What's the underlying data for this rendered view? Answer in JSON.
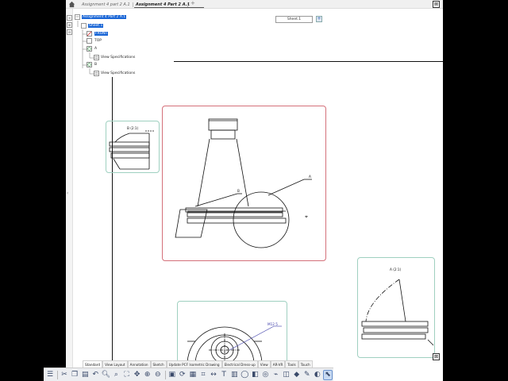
{
  "tabs": [
    {
      "label": "Assignment 4 part 2 A.1",
      "active": false
    },
    {
      "label": "Assignment 4 Part 2 A.1",
      "active": true
    }
  ],
  "add_tab_symbol": "+",
  "sheet_selector": {
    "value": "Sheet.1",
    "add_symbol": "+"
  },
  "tree": {
    "root": "Assignment 4 Part 2 A.1",
    "sheet": "Sheet.1",
    "views": [
      {
        "label": "FRONT",
        "selected": true
      },
      {
        "label": "TOP",
        "selected": false
      },
      {
        "label": "A",
        "selected": false
      },
      {
        "label": "View Specifications",
        "selected": false
      },
      {
        "label": "B",
        "selected": false
      },
      {
        "label": "View Specifications",
        "selected": false
      }
    ]
  },
  "drawing": {
    "detail_b_label": "B (2:1)",
    "detail_a_label": "A (2:1)",
    "callout_a": "A",
    "callout_b": "B",
    "section_callout": "M12 5"
  },
  "command_tabs": [
    {
      "label": "Standard",
      "active": true
    },
    {
      "label": "View Layout",
      "active": false
    },
    {
      "label": "Annotation",
      "active": false
    },
    {
      "label": "Sketch",
      "active": false
    },
    {
      "label": "Update PCF Isometric Drawing",
      "active": false
    },
    {
      "label": "Electrical Dress-up",
      "active": false
    },
    {
      "label": "View",
      "active": false
    },
    {
      "label": "AR-VR",
      "active": false
    },
    {
      "label": "Tools",
      "active": false
    },
    {
      "label": "Touch",
      "active": false
    }
  ],
  "toolbar_icons": [
    "cut-icon",
    "copy-icon",
    "paste-icon",
    "undo-icon",
    "zoom-icon",
    "search-icon",
    "fit-all-icon",
    "pan-icon",
    "zoom-in-icon",
    "zoom-out-icon",
    "normal-view-icon",
    "rotate-icon",
    "grid-icon",
    "snap-icon",
    "dimension-icon",
    "text-icon",
    "table-icon",
    "balloon-icon",
    "section-icon",
    "detail-icon",
    "broken-icon",
    "clipping-icon",
    "fill-icon",
    "style-icon",
    "color-icon",
    "line-icon",
    "select-icon"
  ],
  "colors": {
    "selection": "#1a66d6",
    "active_view_frame": "#d4707a",
    "view_frame": "#9fd0c0",
    "annotation": "#3a3aa8"
  }
}
